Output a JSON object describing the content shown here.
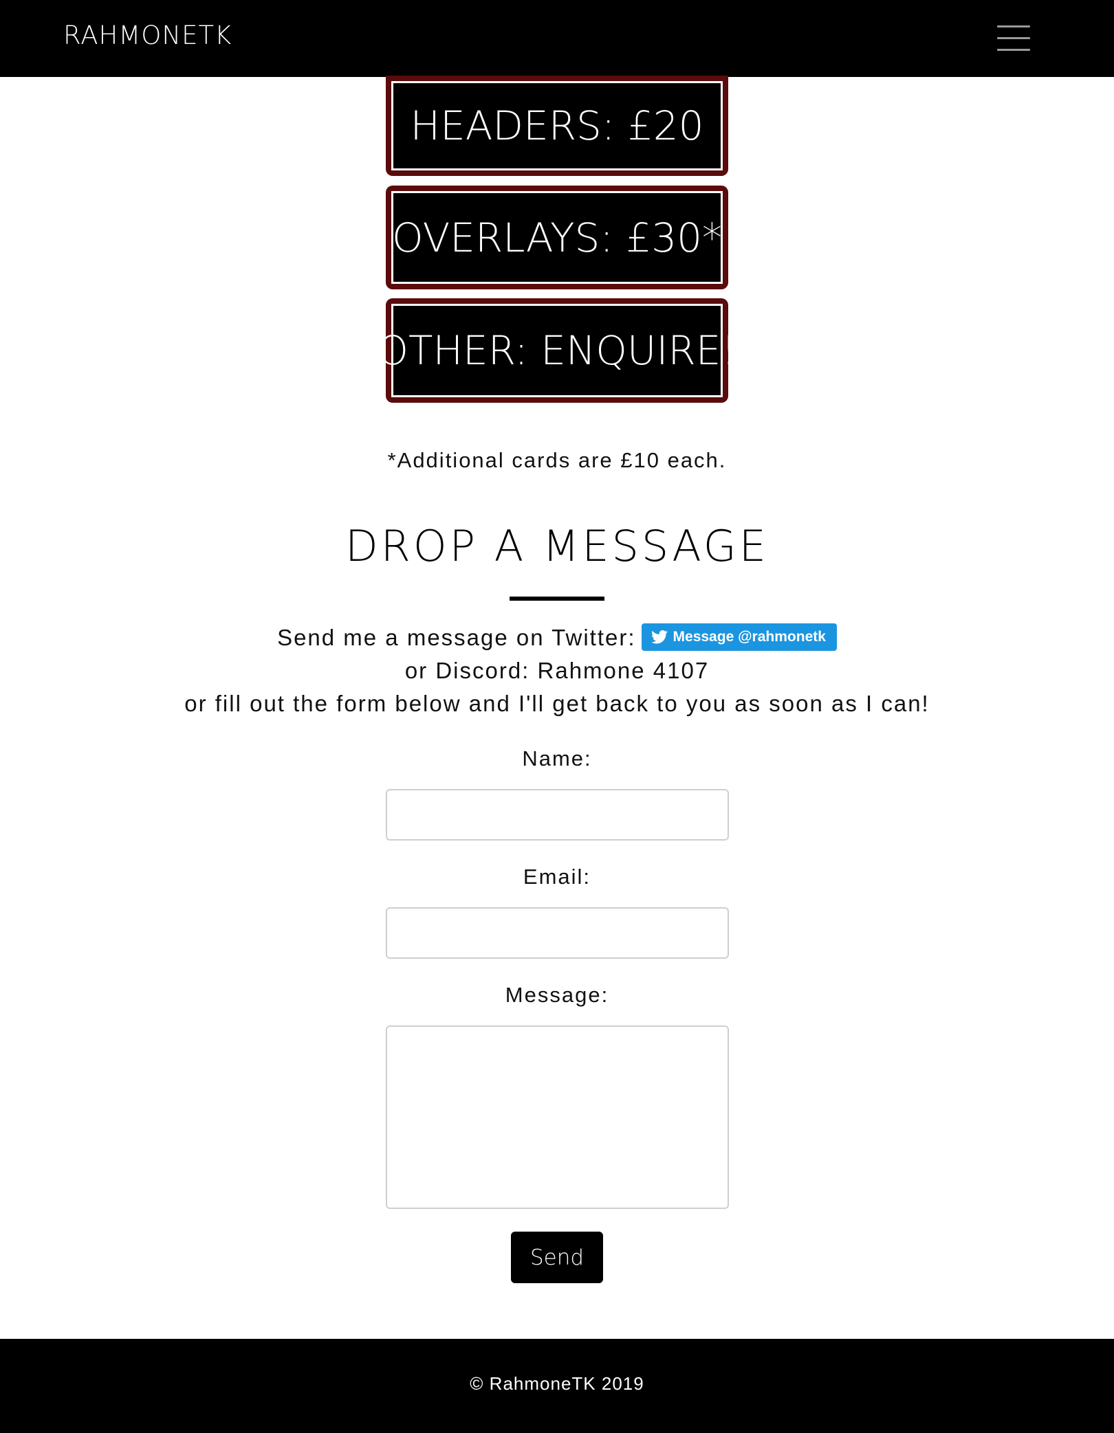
{
  "navbar": {
    "brand": "RAHMONETK",
    "menu_icon": "hamburger-menu-icon"
  },
  "pricing": {
    "cards": [
      {
        "label": "HEADERS: £20"
      },
      {
        "label": "OVERLAYS: £30*"
      },
      {
        "label": "OTHER: ENQUIRE!"
      }
    ],
    "note": "*Additional cards are £10 each."
  },
  "contact": {
    "title": "DROP A MESSAGE",
    "twitter_text": "Send me a message on Twitter:",
    "twitter_button": "Message @rahmonetk",
    "twitter_icon": "twitter-bird-icon",
    "discord_text": "or Discord: Rahmone 4107",
    "form_text": "or fill out the form below and I'll get back to you as soon as I can!"
  },
  "form": {
    "name_label": "Name:",
    "name_value": "",
    "email_label": "Email:",
    "email_value": "",
    "message_label": "Message:",
    "message_value": "",
    "send_label": "Send"
  },
  "footer": {
    "copyright": "© RahmoneTK 2019"
  },
  "colors": {
    "navbar_bg": "#000000",
    "card_border": "#5a0b0b",
    "twitter_blue": "#1b95e0",
    "footer_bg": "#000000"
  }
}
